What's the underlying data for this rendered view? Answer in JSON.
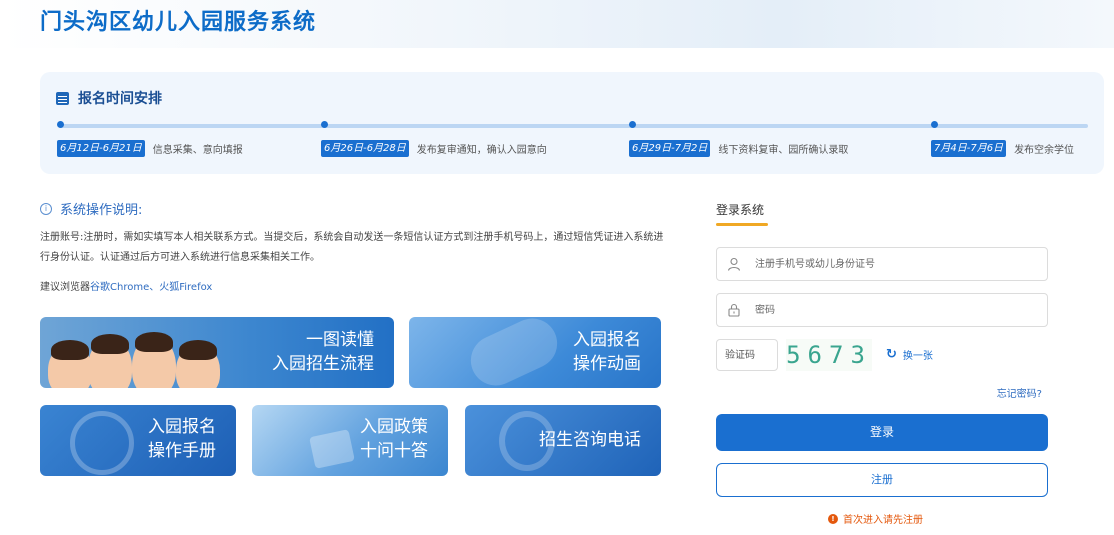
{
  "header": {
    "title": "门头沟区幼儿入园服务系统"
  },
  "schedule": {
    "title": "报名时间安排",
    "items": [
      {
        "date": "6月12日-6月21日",
        "desc": "信息采集、意向填报"
      },
      {
        "date": "6月26日-6月28日",
        "desc": "发布复审通知，确认入园意向"
      },
      {
        "date": "6月29日-7月2日",
        "desc": "线下资料复审、园所确认录取"
      },
      {
        "date": "7月4日-7月6日",
        "desc": "发布空余学位"
      }
    ]
  },
  "instructions": {
    "title": "系统操作说明:",
    "text": "注册账号:注册时，需如实填写本人相关联系方式。当提交后，系统会自动发送一条短信认证方式到注册手机号码上，通过短信凭证进入系统进行身份认证。认证通过后方可进入系统进行信息采集相关工作。",
    "browser_prefix": "建议浏览器",
    "browser_links": "谷歌Chrome、火狐Firefox"
  },
  "tiles": [
    {
      "line1": "一图读懂",
      "line2": "入园招生流程"
    },
    {
      "line1": "入园报名",
      "line2": "操作动画"
    },
    {
      "line1": "入园报名",
      "line2": "操作手册"
    },
    {
      "line1": "入园政策",
      "line2": "十问十答"
    },
    {
      "line1": "招生咨询电话",
      "line2": ""
    }
  ],
  "login": {
    "title": "登录系统",
    "username_placeholder": "注册手机号或幼儿身份证号",
    "password_placeholder": "密码",
    "captcha_placeholder": "验证码",
    "captcha_code": "5673",
    "refresh_label": "换一张",
    "forgot_label": "忘记密码?",
    "login_button": "登录",
    "register_button": "注册",
    "notice": "首次进入请先注册"
  },
  "colors": {
    "primary": "#1a6fd0",
    "title": "#0d6cc8",
    "accent": "#f0a824",
    "warning": "#e4580d"
  }
}
